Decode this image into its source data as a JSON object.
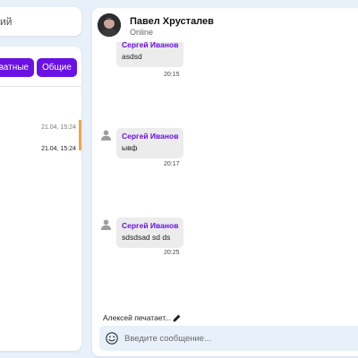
{
  "sidebar": {
    "search_text": "ий",
    "filters": {
      "private_label": "иватные",
      "general_label": "Общие"
    },
    "chats": [
      {
        "time": "21.04, 15:24"
      },
      {
        "time": "21.04, 15:24"
      }
    ]
  },
  "chat": {
    "header": {
      "name": "Павел Хрусталев",
      "status": "Online"
    },
    "messages": [
      {
        "sender": "Сергей Иванов",
        "text": "asdsd",
        "time": "20:15"
      },
      {
        "sender": "Сергей Иванов",
        "text": "ывф",
        "time": "20:17"
      },
      {
        "sender": "Сергей Иванов",
        "text": "sdsdsad sd ds",
        "time": "20:25"
      }
    ],
    "typing_indicator": "Алексей печатает...",
    "composer": {
      "placeholder": "Введите сообщение..."
    }
  },
  "colors": {
    "accent": "#6a11e4",
    "page_bg": "#e8f0f9",
    "active_marker": "#f0a44a",
    "bubble_bg": "#ececec"
  },
  "icons": [
    "user-icon",
    "pencil-icon",
    "emoji-icon",
    "avatar"
  ]
}
